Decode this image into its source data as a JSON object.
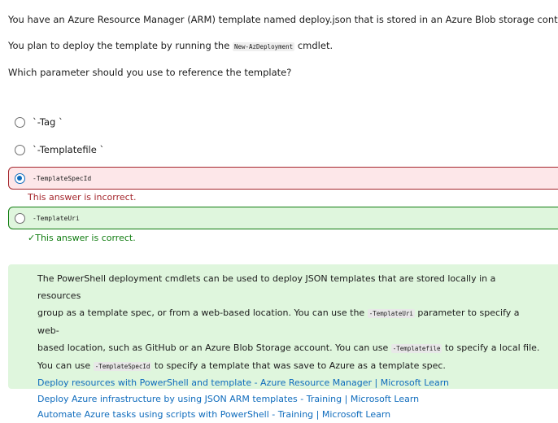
{
  "question": {
    "line1": "You have an Azure Resource Manager (ARM) template named deploy.json that is stored in an Azure Blob storage container.",
    "line2_before": "You plan to deploy the template by running the",
    "line2_code": "New-AzDeployment",
    "line2_after": "cmdlet.",
    "line3": "Which parameter should you use to reference the template?"
  },
  "options": [
    {
      "label": "`-Tag `"
    },
    {
      "label": "`-Templatefile `"
    },
    {
      "label": "-TemplateSpecId",
      "feedback": "This answer is incorrect."
    },
    {
      "label": "-TemplateUri",
      "feedback": "This answer is correct.",
      "check": "✓"
    }
  ],
  "explanation": {
    "t1": "The PowerShell deployment cmdlets can be used to deploy JSON templates that are stored locally in a resources",
    "t2": "group as a template spec, or from a web-based location. You can use the",
    "c1": "-TemplateUri",
    "t3": "parameter to specify a web-",
    "t4": "based location, such as GitHub or an Azure Blob Storage account. You can use",
    "c2": "-Templatefile",
    "t5": "to specify a local file.",
    "t6": "You can use",
    "c3": "-TemplateSpecId",
    "t7": "to specify a template that was save to Azure as a template spec.",
    "links": [
      "Deploy resources with PowerShell and template - Azure Resource Manager | Microsoft Learn",
      "Deploy Azure infrastructure by using JSON ARM templates - Training | Microsoft Learn",
      "Automate Azure tasks using scripts with PowerShell - Training | Microsoft Learn"
    ]
  },
  "colors": {
    "incorrect": "#a4262c",
    "correct": "#107c10",
    "selected": "#0f6cbd",
    "link": "#0f6cbd"
  }
}
